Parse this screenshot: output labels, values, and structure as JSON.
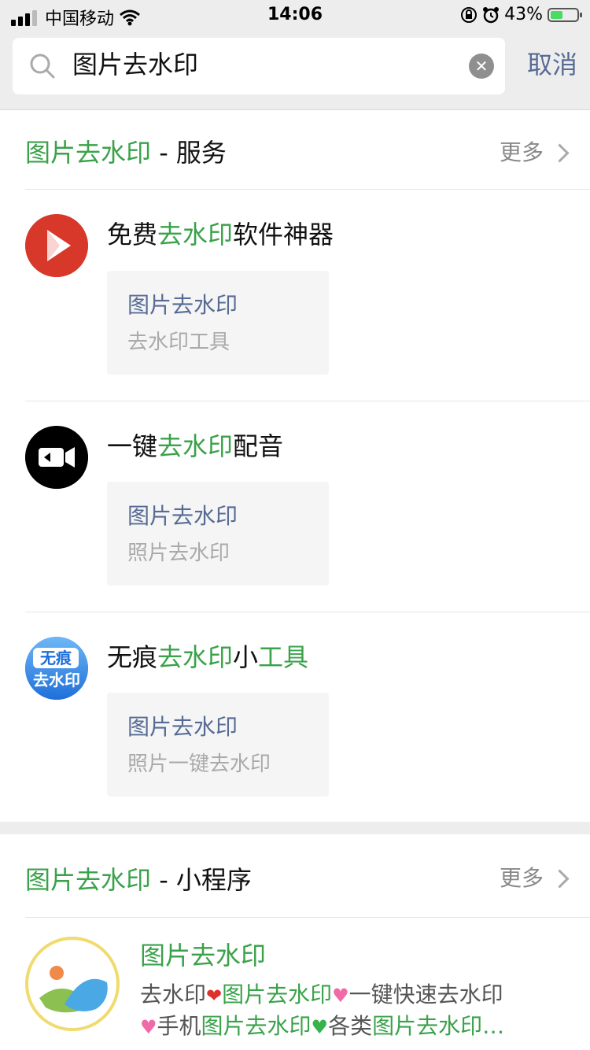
{
  "status_bar": {
    "carrier": "中国移动",
    "time": "14:06",
    "battery": "43%"
  },
  "search": {
    "query": "图片去水印",
    "cancel_label": "取消"
  },
  "services_section": {
    "title_keyword": "图片去水印",
    "title_suffix": " - 服务",
    "more_label": "更多",
    "items": [
      {
        "name_prefix": "免费",
        "name_keyword": "去水印",
        "name_suffix": "软件神器",
        "card_title": "图片去水印",
        "card_subtitle": "去水印工具",
        "icon": "play-icon"
      },
      {
        "name_prefix": "一键",
        "name_keyword": "去水印",
        "name_suffix": "配音",
        "card_title": "图片去水印",
        "card_subtitle": "照片去水印",
        "icon": "video-camera-icon"
      },
      {
        "name_prefix": "无痕",
        "name_keyword": "去水印",
        "name_middle": "小",
        "name_keyword2": "工具",
        "card_title": "图片去水印",
        "card_subtitle": "照片一键去水印",
        "icon": "wuhen-logo-icon",
        "logo_line1": "无痕",
        "logo_line2": "去水印"
      }
    ]
  },
  "miniprogram_section": {
    "title_keyword": "图片去水印",
    "title_suffix": " - 小程序",
    "more_label": "更多",
    "item": {
      "name": "图片去水印",
      "desc_line1": {
        "a": "去水印",
        "b": "图片去水印",
        "c": "一键快速去水印"
      },
      "desc_line2": {
        "a": "手机",
        "b": "图片去水印",
        "c": "各类",
        "d": "图片去水印…"
      }
    }
  },
  "colors": {
    "accent_green": "#3aa24a",
    "link_blue": "#576b95"
  }
}
